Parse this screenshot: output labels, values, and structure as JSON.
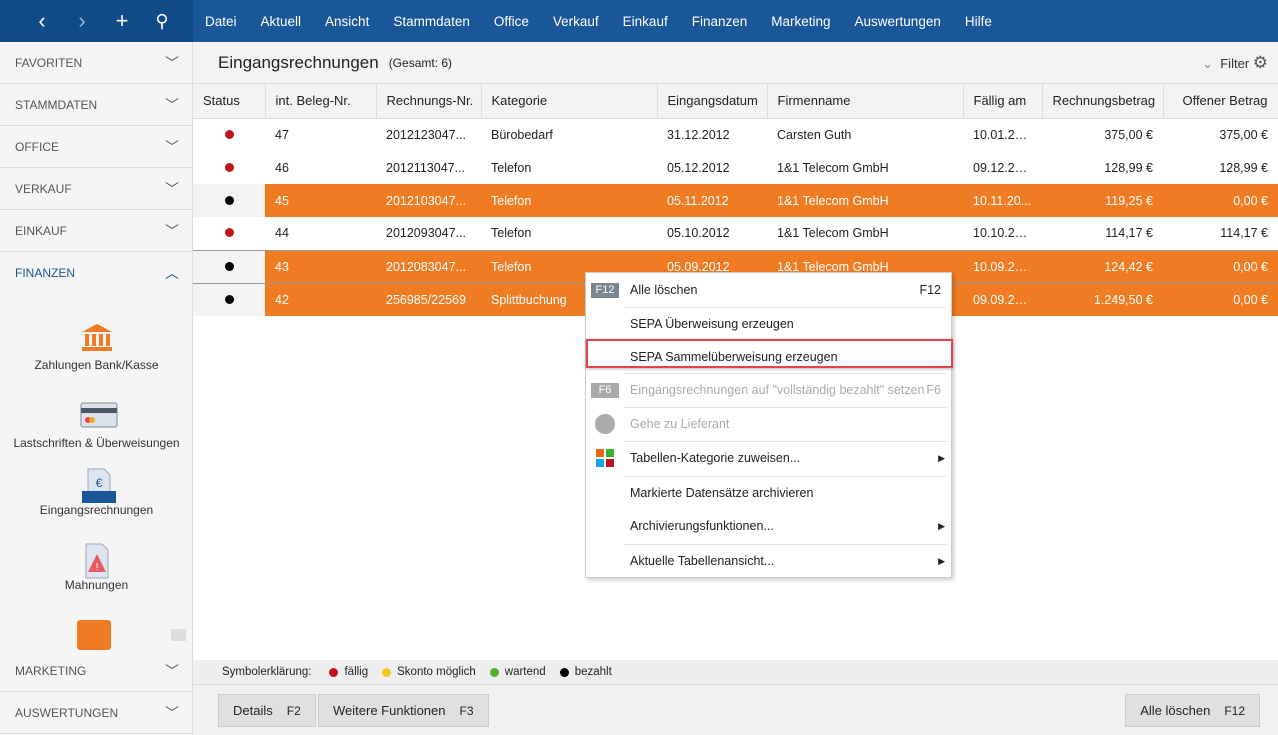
{
  "nav": {
    "back": "‹",
    "forward": "›",
    "add": "+",
    "search": "⚲"
  },
  "menu": [
    "Datei",
    "Aktuell",
    "Ansicht",
    "Stammdaten",
    "Office",
    "Verkauf",
    "Einkauf",
    "Finanzen",
    "Marketing",
    "Auswertungen",
    "Hilfe"
  ],
  "sidebar": {
    "sections": [
      "FAVORITEN",
      "STAMMDATEN",
      "OFFICE",
      "VERKAUF",
      "EINKAUF",
      "FINANZEN",
      "MARKETING",
      "AUSWERTUNGEN"
    ],
    "items": [
      "Zahlungen Bank/Kasse",
      "Lastschriften & Überweisungen",
      "Eingangsrechnungen",
      "Mahnungen"
    ],
    "active": "FINANZEN",
    "accent": "#1a5799"
  },
  "main": {
    "title": "Eingangsrechnungen",
    "total": "(Gesamt: 6)",
    "filter": "Filter"
  },
  "table": {
    "columns": [
      "Status",
      "int. Beleg-Nr.",
      "Rechnungs-Nr.",
      "Kategorie",
      "Eingangsdatum",
      "Firmenname",
      "Fällig am",
      "Rechnungsbetrag",
      "Offener Betrag"
    ],
    "rows": [
      {
        "status": "fällig",
        "cells": [
          "47",
          "2012123047...",
          "Bürobedarf",
          "31.12.2012",
          "Carsten Guth",
          "10.01.20...",
          "375,00 €",
          "375,00 €"
        ],
        "selected": false
      },
      {
        "status": "fällig",
        "cells": [
          "46",
          "2012113047...",
          "Telefon",
          "05.12.2012",
          "1&1 Telecom GmbH",
          "09.12.20...",
          "128,99 €",
          "128,99 €"
        ],
        "selected": false
      },
      {
        "status": "bezahlt",
        "cells": [
          "45",
          "2012103047...",
          "Telefon",
          "05.11.2012",
          "1&1 Telecom GmbH",
          "10.11.20...",
          "119,25 €",
          "0,00 €"
        ],
        "selected": true
      },
      {
        "status": "fällig",
        "cells": [
          "44",
          "2012093047...",
          "Telefon",
          "05.10.2012",
          "1&1 Telecom GmbH",
          "10.10.20...",
          "114,17 €",
          "114,17 €"
        ],
        "selected": false
      },
      {
        "status": "bezahlt",
        "cells": [
          "43",
          "2012083047...",
          "Telefon",
          "05.09.2012",
          "1&1 Telecom GmbH",
          "10.09.20...",
          "124,42 €",
          "0,00 €"
        ],
        "selected": true
      },
      {
        "status": "bezahlt",
        "cells": [
          "42",
          "256985/22569",
          "Splittbuchung",
          "",
          "",
          "09.09.20...",
          "1.249,50 €",
          "0,00 €"
        ],
        "selected": true
      }
    ]
  },
  "legend": {
    "label": "Symbolerklärung:",
    "items": [
      {
        "label": "fällig",
        "color": "#c0141c"
      },
      {
        "label": "Skonto möglich",
        "color": "#f5c71a"
      },
      {
        "label": "wartend",
        "color": "#55b030"
      },
      {
        "label": "bezahlt",
        "color": "#000000"
      }
    ]
  },
  "buttons": {
    "details": "Details",
    "details_key": "F2",
    "more": "Weitere Funktionen",
    "more_key": "F3",
    "delete": "Alle löschen",
    "delete_key": "F12"
  },
  "context_menu": [
    {
      "label": "Alle löschen",
      "shortcut": "F12",
      "key": "F12"
    },
    {
      "label": "SEPA Überweisung erzeugen"
    },
    {
      "label": "SEPA Sammelüberweisung erzeugen",
      "highlighted": true
    },
    {
      "label": "Eingangsrechnungen auf \"vollständig bezahlt\" setzen",
      "shortcut": "F6",
      "key": "F6",
      "disabled": true
    },
    {
      "label": "Gehe zu Lieferant",
      "disabled": true
    },
    {
      "label": "Tabellen-Kategorie zuweisen...",
      "submenu": true
    },
    {
      "label": "Markierte Datensätze archivieren"
    },
    {
      "label": "Archivierungsfunktionen...",
      "submenu": true
    },
    {
      "label": "Aktuelle Tabellenansicht...",
      "submenu": true
    }
  ],
  "colors": {
    "header": "#1a5799",
    "selection": "#ef7b22",
    "highlight_box": "#e8414a"
  }
}
